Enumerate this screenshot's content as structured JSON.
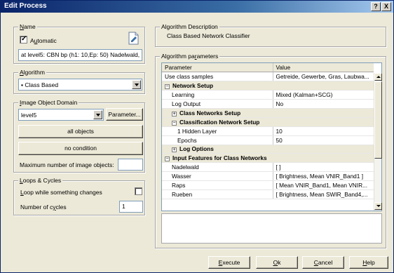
{
  "window": {
    "title": "Edit Process",
    "help_button": "?",
    "close_button": "X"
  },
  "name_group": {
    "title_u": "N",
    "title_rest": "ame",
    "automatic_checked": true,
    "automatic_pre": "A",
    "automatic_u": "u",
    "automatic_rest": "tomatic",
    "name_value": "at level5: CBN bp (h1: 10,Ep: 50) Nadelwald,"
  },
  "algorithm_group": {
    "title_u": "A",
    "title_rest": "lgorithm",
    "selected": "Class Based"
  },
  "domain_group": {
    "title_u": "I",
    "title_rest": "mage Object Domain",
    "level": "level5",
    "parameter_button": "Parameter...",
    "all_objects_button": "all objects",
    "no_condition_button": "no condition",
    "max_label": "Maximum number of image objects:",
    "max_value": ""
  },
  "loops_group": {
    "title_u": "L",
    "title_rest": "oops & Cycles",
    "loop_label_u": "L",
    "loop_label_rest": "oop while something changes",
    "loop_checked": false,
    "cycles_label_pre": "Number of c",
    "cycles_label_u": "y",
    "cycles_label_rest": "cles",
    "cycles_value": "1"
  },
  "description_group": {
    "title": "Algorithm Description",
    "text": "Class Based Network Classifier"
  },
  "params_group": {
    "title_pre": "Algorithm pa",
    "title_u": "r",
    "title_rest": "ameters",
    "col_parameter": "Parameter",
    "col_value": "Value",
    "rows": [
      {
        "name": "Use class samples",
        "value": "Getreide, Gewerbe, Gras, Laubwa..."
      },
      {
        "name": "Network Setup",
        "value": "",
        "expander": "⊟"
      },
      {
        "name": "Learning",
        "value": "Mixed (Kalman+SCG)"
      },
      {
        "name": "Log Output",
        "value": "No"
      },
      {
        "name": "Class Networks Setup",
        "value": "",
        "expander": "⊞"
      },
      {
        "name": "Classification Network Setup",
        "value": "",
        "expander": "⊟"
      },
      {
        "name": "1 Hidden Layer",
        "value": "10"
      },
      {
        "name": "Epochs",
        "value": "50"
      },
      {
        "name": "Log Options",
        "value": "",
        "expander": "⊞"
      },
      {
        "name": "Input Features for Class Networks",
        "value": "",
        "expander": "⊟"
      },
      {
        "name": "Nadelwald",
        "value": "[ ]"
      },
      {
        "name": "Wasser",
        "value": "[ Brightness, Mean VNIR_Band1 ]"
      },
      {
        "name": "Raps",
        "value": "[ Mean VNIR_Band1, Mean VNIR..."
      },
      {
        "name": "Rueben",
        "value": "[ Brightness, Mean SWIR_Band4,..."
      }
    ]
  },
  "buttons": {
    "execute_u": "E",
    "execute_rest": "xecute",
    "ok_u": "O",
    "ok_rest": "k",
    "cancel_u": "C",
    "cancel_rest": "ancel",
    "help_u": "H",
    "help_rest": "elp"
  }
}
